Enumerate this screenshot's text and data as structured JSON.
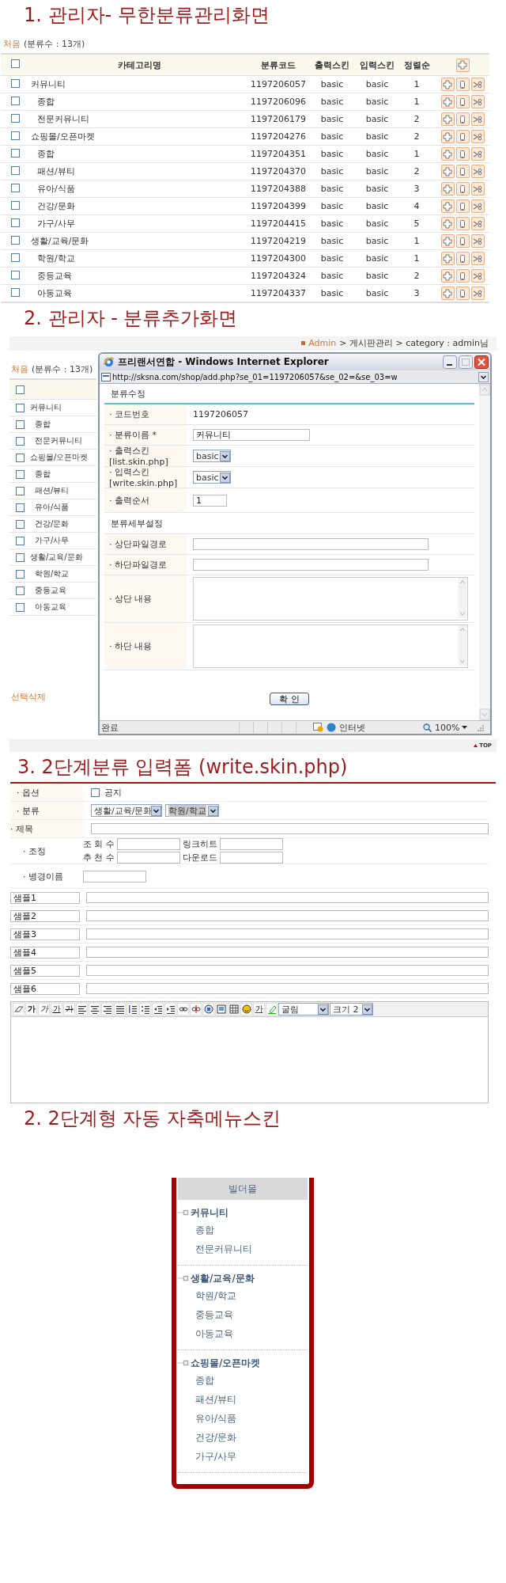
{
  "section_1": {
    "title": "1. 관리자- 무한분류관리화면",
    "summary_link": "처음",
    "summary": "(분류수 : 13개)",
    "table": {
      "header_checked": false,
      "columns": [
        "카테고리명",
        "분류코드",
        "출력스킨",
        "입력스킨",
        "정렬순"
      ],
      "rows": [
        {
          "name": "커뮤니티",
          "code": "1197206057",
          "output_skin": "basic",
          "input_skin": "basic",
          "order": "1",
          "checked": false,
          "children": [
            {
              "name": "종합",
              "code": "1197206096",
              "output_skin": "basic",
              "input_skin": "basic",
              "order": "1",
              "checked": false
            },
            {
              "name": "전문커뮤니티",
              "code": "1197206179",
              "output_skin": "basic",
              "input_skin": "basic",
              "order": "2",
              "checked": false
            }
          ]
        },
        {
          "name": "쇼핑몰/오픈마켓",
          "code": "1197204276",
          "output_skin": "basic",
          "input_skin": "basic",
          "order": "2",
          "checked": false,
          "children": [
            {
              "name": "종합",
              "code": "1197204351",
              "output_skin": "basic",
              "input_skin": "basic",
              "order": "1",
              "checked": false
            },
            {
              "name": "패션/뷰티",
              "code": "1197204370",
              "output_skin": "basic",
              "input_skin": "basic",
              "order": "2",
              "checked": false
            },
            {
              "name": "유아/식품",
              "code": "1197204388",
              "output_skin": "basic",
              "input_skin": "basic",
              "order": "3",
              "checked": false
            },
            {
              "name": "건강/문화",
              "code": "1197204399",
              "output_skin": "basic",
              "input_skin": "basic",
              "order": "4",
              "checked": false
            },
            {
              "name": "가구/사무",
              "code": "1197204415",
              "output_skin": "basic",
              "input_skin": "basic",
              "order": "5",
              "checked": false
            }
          ]
        },
        {
          "name": "생활/교육/문화",
          "code": "1197204219",
          "output_skin": "basic",
          "input_skin": "basic",
          "order": "1",
          "checked": false,
          "children": [
            {
              "name": "학원/학교",
              "code": "1197204300",
              "output_skin": "basic",
              "input_skin": "basic",
              "order": "1",
              "checked": false
            },
            {
              "name": "중등교육",
              "code": "1197204324",
              "output_skin": "basic",
              "input_skin": "basic",
              "order": "2",
              "checked": false
            },
            {
              "name": "아동교육",
              "code": "1197204337",
              "output_skin": "basic",
              "input_skin": "basic",
              "order": "3",
              "checked": false
            }
          ]
        }
      ]
    }
  },
  "section_2": {
    "title": "2. 관리자 - 분류추가화면",
    "background_page": {
      "breadcrumb_link": "Admin",
      "breadcrumb_rest": "> 게시판관리 > category : admin님",
      "summary_link": "처음",
      "summary": "(분류수 : 13개)",
      "header_checked": false,
      "rows": [
        {
          "name": "커뮤니티",
          "checked": false,
          "children": [
            {
              "name": "종합",
              "checked": false
            },
            {
              "name": "전문커뮤니티",
              "checked": false
            }
          ]
        },
        {
          "name": "쇼핑몰/오픈마켓",
          "checked": false,
          "children": [
            {
              "name": "종합",
              "checked": false
            },
            {
              "name": "패션/뷰티",
              "checked": false
            },
            {
              "name": "유아/식품",
              "checked": false
            },
            {
              "name": "건강/문화",
              "checked": false
            },
            {
              "name": "가구/사무",
              "checked": false
            }
          ]
        },
        {
          "name": "생활/교육/문화",
          "checked": false,
          "children": [
            {
              "name": "학원/학교",
              "checked": false
            },
            {
              "name": "중등교육",
              "checked": false
            },
            {
              "name": "아동교육",
              "checked": false
            }
          ]
        }
      ],
      "delete_link": "선택삭제",
      "top_link": "TOP"
    },
    "popup": {
      "title": "프리랜서연합 - Windows Internet Explorer",
      "url": "http://sksna.com/shop/add.php?se_01=1197206057&se_02=&se_03=w",
      "heading": "분류수정",
      "fields": [
        {
          "kind": "text",
          "label": "· 코드번호",
          "value": "1197206057"
        },
        {
          "kind": "input",
          "label": "· 분류이름 *",
          "value": "커뮤니티"
        },
        {
          "kind": "select",
          "label": "· 출력스킨",
          "sublabel": "[list.skin.php]",
          "value": "basic"
        },
        {
          "kind": "select",
          "label": "· 입력스킨",
          "sublabel": "[write.skin.php]",
          "value": "basic"
        },
        {
          "kind": "short_input",
          "label": "· 출력순서",
          "value": "1"
        },
        {
          "kind": "section",
          "label": "분류세부설정"
        },
        {
          "kind": "wide_input",
          "label": "· 상단파일경로"
        },
        {
          "kind": "wide_input",
          "label": "· 하단파일경로"
        },
        {
          "kind": "textarea",
          "label": "· 상단 내용"
        },
        {
          "kind": "textarea",
          "label": "· 하단 내용"
        }
      ],
      "button": "확 인",
      "status": "완료",
      "zone": "인터넷",
      "zoom": "100%"
    }
  },
  "section_3": {
    "title": "3. 2단계분류 입력폼 (write.skin.php)",
    "rows": [
      {
        "kind": "checkbox",
        "label": "· 옵션",
        "option": "공지",
        "checked": false
      },
      {
        "kind": "selects",
        "label": "· 분류",
        "values": [
          "생활/교육/문화",
          "학원/학교"
        ]
      },
      {
        "kind": "input",
        "label": "· 제목"
      },
      {
        "kind": "counters",
        "label": "· 조정",
        "fields": [
          "조 회 수",
          "링크히트",
          "추 천 수",
          "다운로드"
        ]
      },
      {
        "kind": "short_input",
        "label": "· 병경이름"
      }
    ],
    "samples": [
      "샘플1",
      "샘플2",
      "샘플3",
      "샘플4",
      "샘플5",
      "샘플6"
    ],
    "editor": {
      "text_buttons": [
        {
          "kind": "bold",
          "label": "가"
        },
        {
          "kind": "italic",
          "label": "가"
        },
        {
          "kind": "underline",
          "label": "가"
        },
        {
          "kind": "strike",
          "label": "가"
        },
        {
          "kind": "color",
          "label": "가"
        }
      ],
      "font": "굴림",
      "size": "크기 2"
    }
  },
  "section_4": {
    "title": "2. 2단계형 자동 자축메뉴스킨",
    "menu": {
      "header": "빌더몰",
      "groups": [
        {
          "name": "커뮤니티",
          "children": [
            {
              "name": "종합"
            },
            {
              "name": "전문커뮤니티"
            }
          ]
        },
        {
          "name": "생활/교육/문화",
          "children": [
            {
              "name": "학원/학교"
            },
            {
              "name": "중등교육"
            },
            {
              "name": "아동교육"
            }
          ]
        },
        {
          "name": "쇼핑몰/오픈마켓",
          "children": [
            {
              "name": "종합"
            },
            {
              "name": "패션/뷰티"
            },
            {
              "name": "유아/식품"
            },
            {
              "name": "건강/문화"
            },
            {
              "name": "가구/사무"
            }
          ]
        }
      ]
    }
  }
}
